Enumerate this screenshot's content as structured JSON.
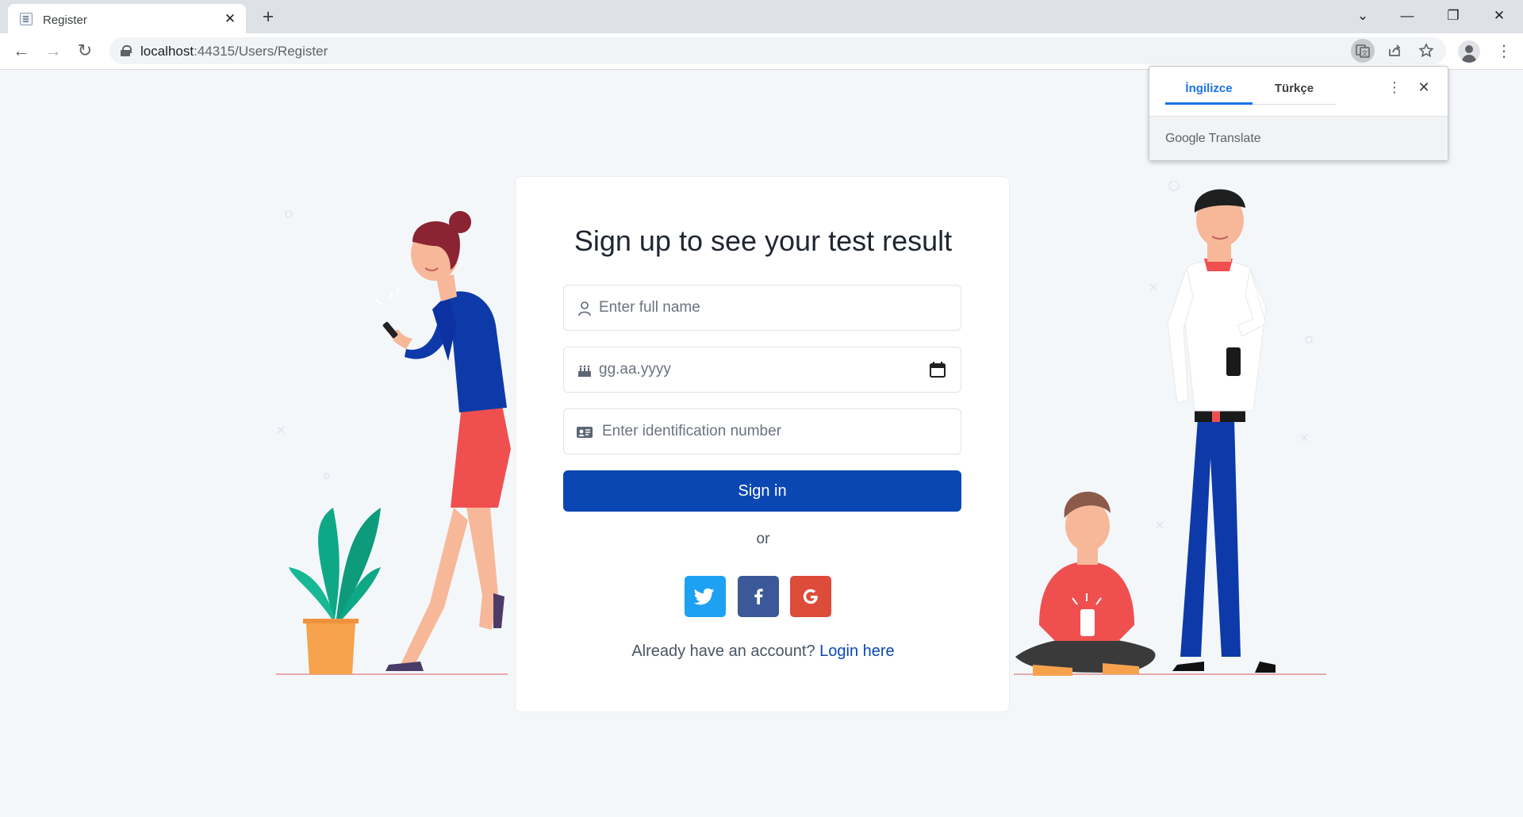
{
  "browser": {
    "tab_title": "Register",
    "tab_close": "✕",
    "new_tab": "+",
    "url_host": "localhost",
    "url_rest": ":44315/Users/Register",
    "window_controls": [
      "⌄",
      "—",
      "❐",
      "✕"
    ],
    "nav": {
      "back": "←",
      "forward": "→",
      "reload": "↻"
    },
    "icons": [
      "translate-icon",
      "share-icon",
      "star-icon",
      "profile-icon",
      "kebab-menu-icon"
    ]
  },
  "translate_popup": {
    "tab_source": "İngilizce",
    "tab_target": "Türkçe",
    "menu": "⋮",
    "close": "✕",
    "brand_google": "Google",
    "brand_translate": "Translate"
  },
  "form": {
    "title": "Sign up to see your test result",
    "fullname_placeholder": "Enter full name",
    "date_placeholder": "gg.aa.yyyy",
    "id_placeholder": "Enter identification number",
    "submit_label": "Sign in",
    "or_label": "or",
    "social": {
      "twitter": "t",
      "facebook": "f",
      "google": "G"
    },
    "already_text": "Already have an account?",
    "login_link": "Login here"
  },
  "colors": {
    "primary": "#0b47b3",
    "twitter": "#1da1f2",
    "facebook": "#3b5998",
    "google": "#dd4b39",
    "page_bg": "#f4f7fa"
  }
}
